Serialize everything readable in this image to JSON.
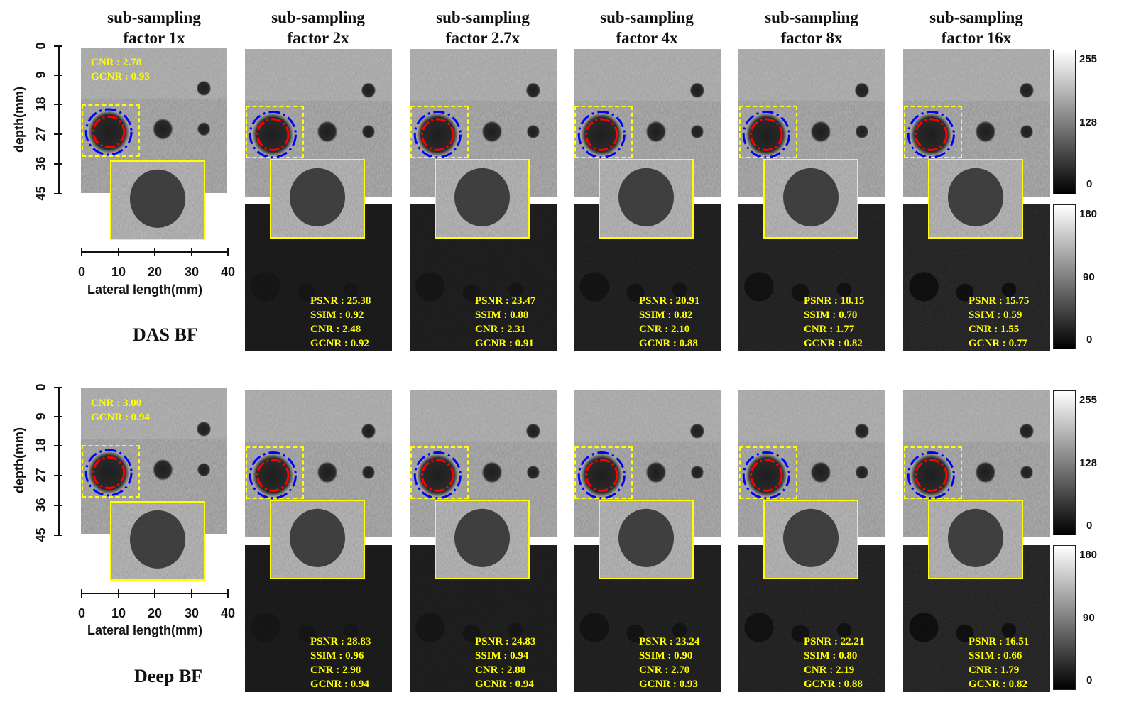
{
  "columns": [
    {
      "line1": "sub-sampling",
      "line2": "factor 1x"
    },
    {
      "line1": "sub-sampling",
      "line2": "factor 2x"
    },
    {
      "line1": "sub-sampling",
      "line2": "factor 2.7x"
    },
    {
      "line1": "sub-sampling",
      "line2": "factor 4x"
    },
    {
      "line1": "sub-sampling",
      "line2": "factor 8x"
    },
    {
      "line1": "sub-sampling",
      "line2": "factor 16x"
    }
  ],
  "rows": [
    {
      "label": "DAS BF",
      "reference": {
        "cnr": "CNR : 2.78",
        "gcnr": "GCNR : 0.93"
      },
      "panels": [
        {
          "psnr": "PSNR : 25.38",
          "ssim": "SSIM : 0.92",
          "cnr": "CNR : 2.48",
          "gcnr": "GCNR : 0.92"
        },
        {
          "psnr": "PSNR : 23.47",
          "ssim": "SSIM : 0.88",
          "cnr": "CNR : 2.31",
          "gcnr": "GCNR : 0.91"
        },
        {
          "psnr": "PSNR : 20.91",
          "ssim": "SSIM : 0.82",
          "cnr": "CNR : 2.10",
          "gcnr": "GCNR : 0.88"
        },
        {
          "psnr": "PSNR : 18.15",
          "ssim": "SSIM : 0.70",
          "cnr": "CNR : 1.77",
          "gcnr": "GCNR : 0.82"
        },
        {
          "psnr": "PSNR : 15.75",
          "ssim": "SSIM : 0.59",
          "cnr": "CNR : 1.55",
          "gcnr": "GCNR : 0.77"
        }
      ]
    },
    {
      "label": "Deep BF",
      "reference": {
        "cnr": "CNR : 3.00",
        "gcnr": "GCNR : 0.94"
      },
      "panels": [
        {
          "psnr": "PSNR : 28.83",
          "ssim": "SSIM : 0.96",
          "cnr": "CNR : 2.98",
          "gcnr": "GCNR : 0.94"
        },
        {
          "psnr": "PSNR : 24.83",
          "ssim": "SSIM : 0.94",
          "cnr": "CNR : 2.88",
          "gcnr": "GCNR : 0.94"
        },
        {
          "psnr": "PSNR : 23.24",
          "ssim": "SSIM : 0.90",
          "cnr": "CNR : 2.70",
          "gcnr": "GCNR : 0.93"
        },
        {
          "psnr": "PSNR : 22.21",
          "ssim": "SSIM : 0.80",
          "cnr": "CNR : 2.19",
          "gcnr": "GCNR : 0.88"
        },
        {
          "psnr": "PSNR : 16.51",
          "ssim": "SSIM : 0.66",
          "cnr": "CNR : 1.79",
          "gcnr": "GCNR : 0.82"
        }
      ]
    }
  ],
  "axes": {
    "y_label": "depth(mm)",
    "y_ticks": [
      "0",
      "9",
      "18",
      "27",
      "36",
      "45"
    ],
    "x_label": "Lateral length(mm)",
    "x_ticks": [
      "0",
      "10",
      "20",
      "30",
      "40"
    ]
  },
  "colorbars": {
    "image_ticks": [
      "255",
      "128",
      "0"
    ],
    "diff_ticks": [
      "180",
      "90",
      "0"
    ]
  },
  "colors": {
    "annotation": "#ffff00",
    "roi_inner": "#ff0000",
    "roi_outer": "#0000ff"
  }
}
